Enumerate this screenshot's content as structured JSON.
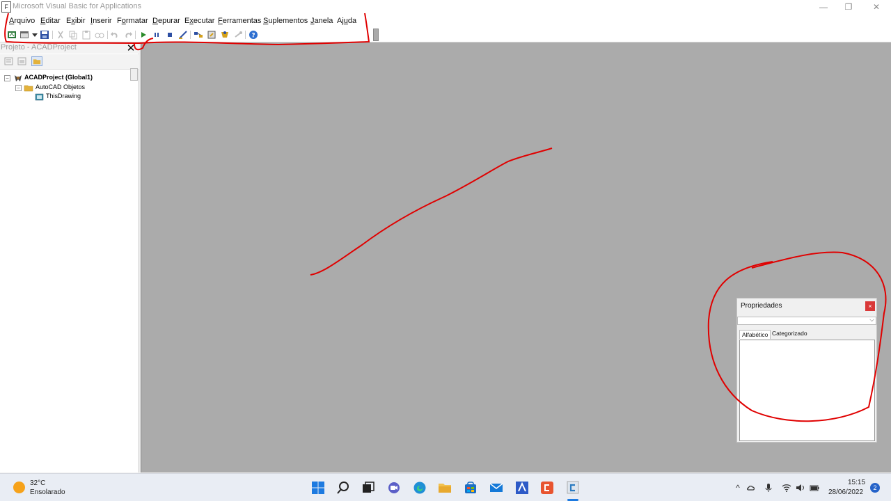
{
  "window": {
    "title": "Microsoft Visual Basic for Applications",
    "app_icon_glyph": "F",
    "controls": {
      "minimize": "—",
      "restore": "❐",
      "close": "✕"
    }
  },
  "menu": [
    {
      "label": "Arquivo",
      "hotkey": "A",
      "rest": "rquivo"
    },
    {
      "label": "Editar",
      "hotkey": "E",
      "rest": "ditar"
    },
    {
      "label": "Exibir",
      "hotkey": "x",
      "pre": "E",
      "rest": "ibir"
    },
    {
      "label": "Inserir",
      "hotkey": "I",
      "rest": "nserir"
    },
    {
      "label": "Formatar",
      "hotkey": "o",
      "pre": "F",
      "rest": "rmatar"
    },
    {
      "label": "Depurar",
      "hotkey": "D",
      "rest": "epurar"
    },
    {
      "label": "Executar",
      "hotkey": "x",
      "pre": "E",
      "rest": "ecutar"
    },
    {
      "label": "Ferramentas",
      "hotkey": "F",
      "rest": "erramentas"
    },
    {
      "label": "Suplementos",
      "hotkey": "S",
      "rest": "uplementos"
    },
    {
      "label": "Janela",
      "hotkey": "J",
      "rest": "anela"
    },
    {
      "label": "Ajuda",
      "hotkey": "u",
      "pre": "Aj",
      "rest": "da"
    }
  ],
  "project": {
    "title": "Projeto - ACADProject",
    "close_glyph": "✕",
    "tree": {
      "root": "ACADProject (Global1)",
      "folder": "AutoCAD Objetos",
      "item": "ThisDrawing"
    }
  },
  "properties": {
    "title": "Propriedades",
    "close_glyph": "×",
    "tabs": [
      "Alfabético",
      "Categorizado"
    ]
  },
  "taskbar": {
    "weather_temp": "32°C",
    "weather_desc": "Ensolarado",
    "time": "15:15",
    "date": "28/06/2022",
    "notifications": "2"
  },
  "colors": {
    "annotation": "#e00000",
    "mdi_background": "#ababab",
    "close_red": "#d93838"
  }
}
